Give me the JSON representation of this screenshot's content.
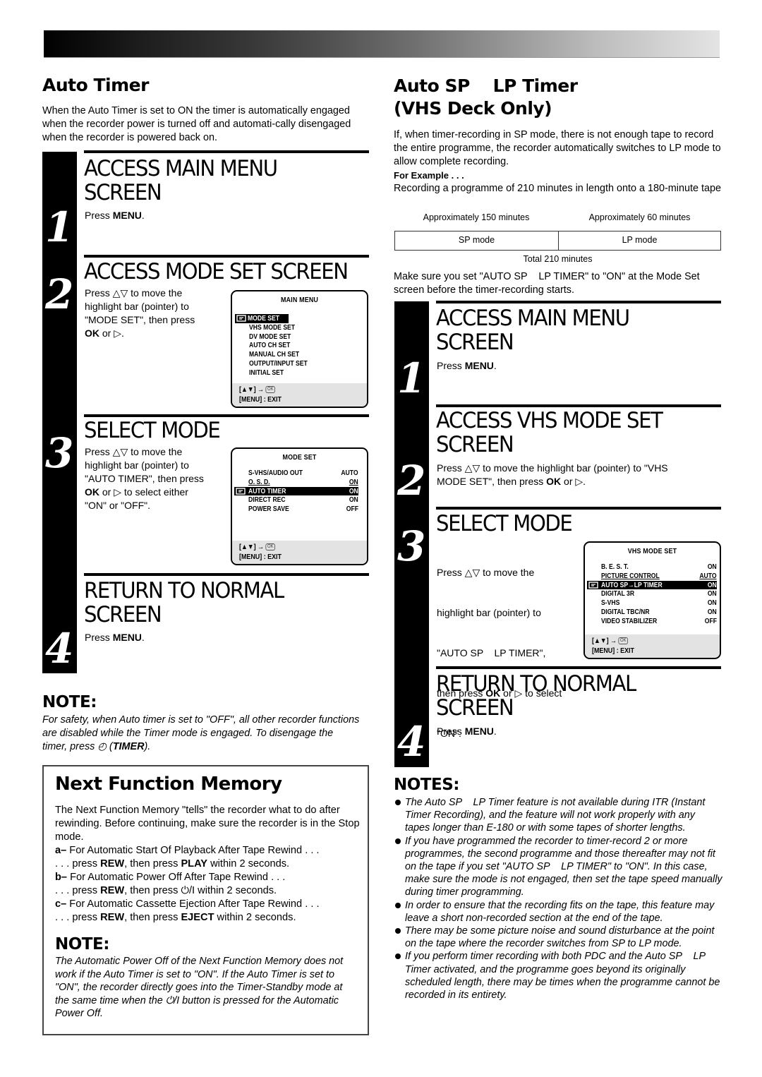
{
  "left": {
    "auto_timer": {
      "title": "Auto Timer",
      "body": "When the Auto Timer is set to ON the timer is automatically engaged when the recorder power is turned off and automati-cally disengaged when the recorder is powered back on."
    },
    "steps": [
      {
        "num": "1",
        "title_l1": "ACCESS MAIN MENU",
        "title_l2": "SCREEN",
        "text_pre": "Press ",
        "text_bold": "MENU",
        "text_post": "."
      },
      {
        "num": "2",
        "title_l1": "ACCESS MODE SET SCREEN",
        "text": [
          "Press △▽ to move the",
          "highlight bar (pointer) to",
          "\"MODE SET\", then press"
        ],
        "ok_bold": "OK",
        "ok_post": " or ▷."
      },
      {
        "num": "3",
        "title_l1": "SELECT MODE",
        "text": [
          "Press △▽ to move the",
          "highlight bar (pointer) to",
          "\"AUTO TIMER\", then press"
        ],
        "ok_bold": "OK",
        "ok_post": " or ▷ to select either",
        "text_last": "\"ON\" or \"OFF\"."
      },
      {
        "num": "4",
        "title_l1": "RETURN TO NORMAL",
        "title_l2": "SCREEN",
        "text_pre": "Press ",
        "text_bold": "MENU",
        "text_post": "."
      }
    ],
    "main_menu_osd": {
      "title": "MAIN MENU",
      "items": [
        "MODE SET",
        "VHS MODE SET",
        "DV MODE SET",
        "AUTO CH SET",
        "MANUAL CH SET",
        "OUTPUT/INPUT SET",
        "INITIAL SET"
      ],
      "selected": "MODE SET",
      "footer_nav": "[▲▼] →",
      "footer_ok": "OK",
      "footer_exit": "[MENU] : EXIT"
    },
    "mode_set_osd": {
      "title": "MODE SET",
      "items": [
        {
          "label": "S-VHS/AUDIO OUT",
          "value": "AUTO"
        },
        {
          "label": "O. S. D.",
          "value": "ON"
        },
        {
          "label": "AUTO TIMER",
          "value": "ON",
          "selected": true
        },
        {
          "label": "DIRECT REC",
          "value": "ON"
        },
        {
          "label": "POWER SAVE",
          "value": "OFF"
        }
      ],
      "footer_nav": "[▲▼] →",
      "footer_ok": "OK",
      "footer_exit": "[MENU] : EXIT"
    },
    "note": {
      "heading": "NOTE:",
      "body_pre": "For safety, when Auto timer is set to \"OFF\", all other recorder functions are disabled while the Timer mode is engaged. To disengage the timer, press ◴ (",
      "body_bold": "TIMER",
      "body_post": ")."
    },
    "next_function_memory": {
      "title": "Next Function Memory",
      "intro": "The Next Function Memory \"tells\" the recorder what to do after rewinding. Before continuing, make sure the recorder is in the Stop mode.",
      "items": [
        {
          "letter": "a–",
          "desc": " For Automatic Start Of Playback After Tape Rewind . . .",
          "action_pre": ". . . press ",
          "key1": "REW",
          "action_mid": ", then press ",
          "key2": "PLAY",
          "action_post": " within 2 seconds."
        },
        {
          "letter": "b–",
          "desc": " For Automatic Power Off After Tape Rewind . . .",
          "action_pre": ". . . press ",
          "key1": "REW",
          "action_mid": ", then press ",
          "key2": "⏻/I",
          "key2_plain": true,
          "action_post": " within 2 seconds."
        },
        {
          "letter": "c–",
          "desc": " For Automatic Cassette Ejection After Tape Rewind . . .",
          "action_pre": ". . . press ",
          "key1": "REW",
          "action_mid": ", then press ",
          "key2": "EJECT",
          "action_post": " within 2 seconds."
        }
      ],
      "note_heading": "NOTE:",
      "note_body": "The Automatic Power Off of the Next Function Memory does not work if the Auto Timer is set to \"ON\". If the Auto Timer is set to \"ON\", the recorder directly goes into the Timer-Standby mode at the same time when the ⏻/I button is pressed for the Automatic Power Off."
    }
  },
  "right": {
    "auto_sp_lp": {
      "title_l1": "Auto SP    LP Timer",
      "title_l2": "(VHS Deck Only)",
      "body": "If, when timer-recording in SP mode, there is not enough tape to record the entire programme, the recorder automatically switches to LP mode to allow complete recording.",
      "example_label": "For Example . . .",
      "example_text": "Recording a programme of 210 minutes in length onto a 180-minute tape",
      "tape_diagram": {
        "sp_duration": "Approximately 150 minutes",
        "lp_duration": "Approximately 60 minutes",
        "sp_label": "SP mode",
        "lp_label": "LP mode",
        "total": "Total 210 minutes",
        "sp_minutes": 150,
        "lp_minutes": 60
      },
      "reminder": "Make sure you set \"AUTO SP    LP TIMER\" to \"ON\" at the Mode Set screen before the timer-recording starts."
    },
    "steps": [
      {
        "num": "1",
        "title_l1": "ACCESS MAIN MENU",
        "title_l2": "SCREEN",
        "text_pre": "Press ",
        "text_bold": "MENU",
        "text_post": "."
      },
      {
        "num": "2",
        "title_l1": "ACCESS VHS MODE SET",
        "title_l2": "SCREEN",
        "text_l1": "Press △▽ to move the highlight bar (pointer) to \"VHS",
        "text_l2_pre": "MODE SET\", then press ",
        "ok_bold": "OK",
        "ok_post": " or ▷."
      },
      {
        "num": "3",
        "title_l1": "SELECT MODE",
        "text": [
          "Press △▽ to move the",
          "highlight bar (pointer) to",
          "\"AUTO SP    LP TIMER\","
        ],
        "text_then_pre": "then press ",
        "ok_bold": "OK",
        "ok_post": " or ▷ to select",
        "text_last": "\"ON\"."
      },
      {
        "num": "4",
        "title_l1": "RETURN TO NORMAL",
        "title_l2": "SCREEN",
        "text_pre": "Press ",
        "text_bold": "MENU",
        "text_post": "."
      }
    ],
    "vhs_mode_set_osd": {
      "title": "VHS MODE SET",
      "items": [
        {
          "label": "B. E. S. T.",
          "value": "ON"
        },
        {
          "label": "PICTURE CONTROL",
          "value": "AUTO"
        },
        {
          "label": "AUTO SP→LP TIMER",
          "value": "ON",
          "selected": true
        },
        {
          "label": "DIGITAL 3R",
          "value": "ON"
        },
        {
          "label": "S-VHS",
          "value": "ON"
        },
        {
          "label": "DIGITAL TBC/NR",
          "value": "ON"
        },
        {
          "label": "VIDEO STABILIZER",
          "value": "OFF"
        }
      ],
      "footer_nav": "[▲▼] →",
      "footer_ok": "OK",
      "footer_exit": "[MENU] : EXIT"
    },
    "notes": {
      "heading": "NOTES:",
      "items": [
        "The Auto SP    LP Timer feature is not available during ITR (Instant Timer Recording), and the feature will not work properly with any tapes longer than E-180 or with some tapes of shorter lengths.",
        "If you have programmed the recorder to timer-record 2 or more programmes, the second programme and those thereafter may not fit on the tape if you set \"AUTO SP    LP TIMER\" to \"ON\". In this case, make sure the mode is not engaged, then set the tape speed manually during timer programming.",
        "In order to ensure that the recording fits on the tape, this feature may leave a short non-recorded section at the end of the tape.",
        "There may be some picture noise and sound disturbance at the point on the tape where the recorder switches from SP to LP mode.",
        "If you perform timer recording with both PDC and the Auto SP    LP Timer activated, and the programme goes beyond its originally scheduled length, there may be times when the programme cannot be recorded in its entirety."
      ]
    }
  }
}
